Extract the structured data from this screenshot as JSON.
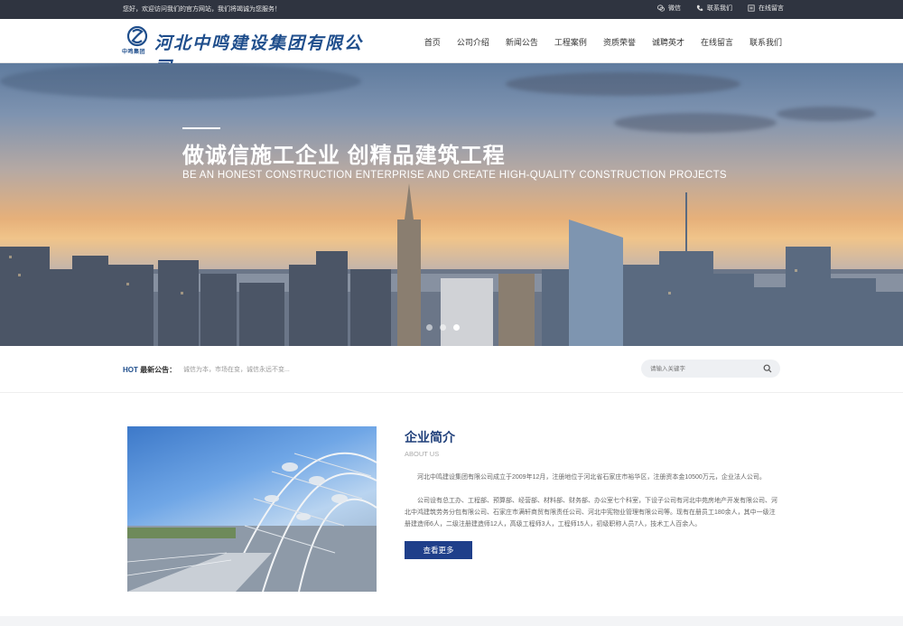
{
  "topbar": {
    "welcome": "您好，欢迎访问我们的官方网站，我们将竭诚为您服务！",
    "links": [
      {
        "label": "微信",
        "icon": "wechat-icon"
      },
      {
        "label": "联系我们",
        "icon": "phone-icon"
      },
      {
        "label": "在线留言",
        "icon": "message-icon"
      }
    ]
  },
  "header": {
    "logo_name": "河北中鸣建设集团有限公司",
    "logo_sub": "中鸣集团",
    "nav": [
      "首页",
      "公司介绍",
      "新闻公告",
      "工程案例",
      "资质荣誉",
      "诚聘英才",
      "在线留言",
      "联系我们"
    ]
  },
  "banner": {
    "title": "做诚信施工企业  创精品建筑工程",
    "subtitle": "BE AN HONEST CONSTRUCTION ENTERPRISE AND CREATE HIGH-QUALITY CONSTRUCTION PROJECTS",
    "slides": 3,
    "active_slide": 2
  },
  "notice": {
    "hot": "HOT",
    "label": "最新公告：",
    "text": "诚信为本，市场在变，诚信永远不变...",
    "search_placeholder": "请输入关键字"
  },
  "about": {
    "title": "企业简介",
    "title_en": "ABOUT US",
    "paragraphs": [
      "河北中鸣建设集团有限公司成立于2009年12月，注册地位于河北省石家庄市裕华区，注册资本金10500万元，企业法人公司。",
      "公司设有总工办、工程部、预算部、经营部、材料部、财务部、办公室七个科室，下设子公司有河北中苑房地产开发有限公司、河北中鸿建筑劳务分包有限公司、石家庄市满轩商贸有限责任公司、河北中宪物业管理有限公司等。现有在册员工180余人，其中一级注册建造师6人，二级注册建造师12人，高级工程师3人，工程师15人，初级职称人员7人，技术工人百余人。"
    ],
    "more_label": "查看更多"
  },
  "colors": {
    "topbar": "#2f3440",
    "brand": "#1f4e8c",
    "button": "#1f3f8a"
  }
}
